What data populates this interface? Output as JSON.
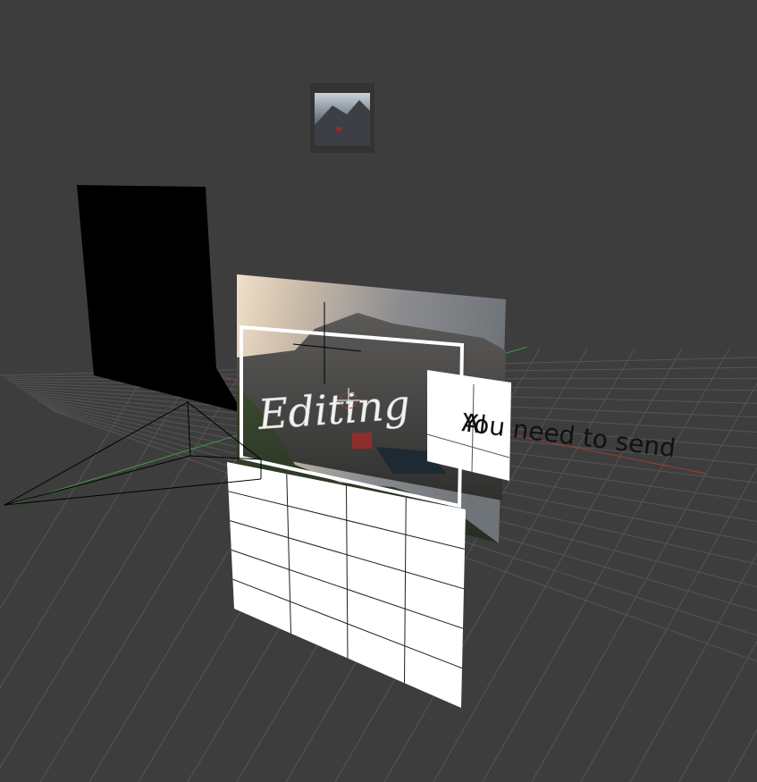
{
  "viewport": {
    "background": "#3d3d3d",
    "grid_color": "#555555",
    "x_axis_color": "#a33a3a",
    "y_axis_color": "#3f9a3f"
  },
  "layers": {
    "title_text": "Editing",
    "caption_text": "You need to send",
    "caption_overlap_text": "Al"
  },
  "icons": {
    "camera": "camera-frustum-icon",
    "cursor": "3d-cursor-icon",
    "thumbnail": "image-thumbnail-icon"
  }
}
